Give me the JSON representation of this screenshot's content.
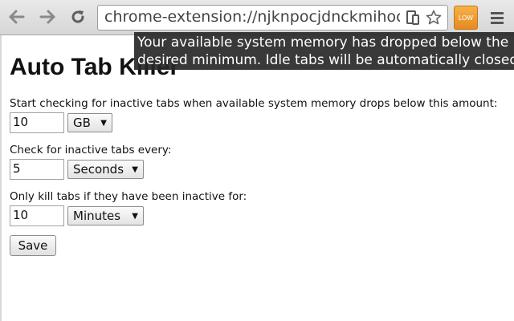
{
  "browser": {
    "url": "chrome-extension://njknpocjdnckmihoc",
    "extension_badge": "LOW",
    "icons": {
      "back": "back-arrow-icon",
      "forward": "forward-arrow-icon",
      "reload": "reload-icon",
      "page_action": "tablet-icon",
      "bookmark": "star-icon",
      "menu": "hamburger-menu-icon"
    }
  },
  "notice": {
    "line1": "Your available system memory has dropped below the",
    "line2": "desired minimum. Idle tabs will be automatically closed"
  },
  "page": {
    "title": "Auto Tab Killer"
  },
  "settings": [
    {
      "label": "Start checking for inactive tabs when available system memory drops below this amount:",
      "value": "10",
      "unit": "GB"
    },
    {
      "label": "Check for inactive tabs every:",
      "value": "5",
      "unit": "Seconds"
    },
    {
      "label": "Only kill tabs if they have been inactive for:",
      "value": "10",
      "unit": "Minutes"
    }
  ],
  "save_label": "Save",
  "colors": {
    "extension_badge": "#e58a1f",
    "notice_bg": "#282828"
  }
}
